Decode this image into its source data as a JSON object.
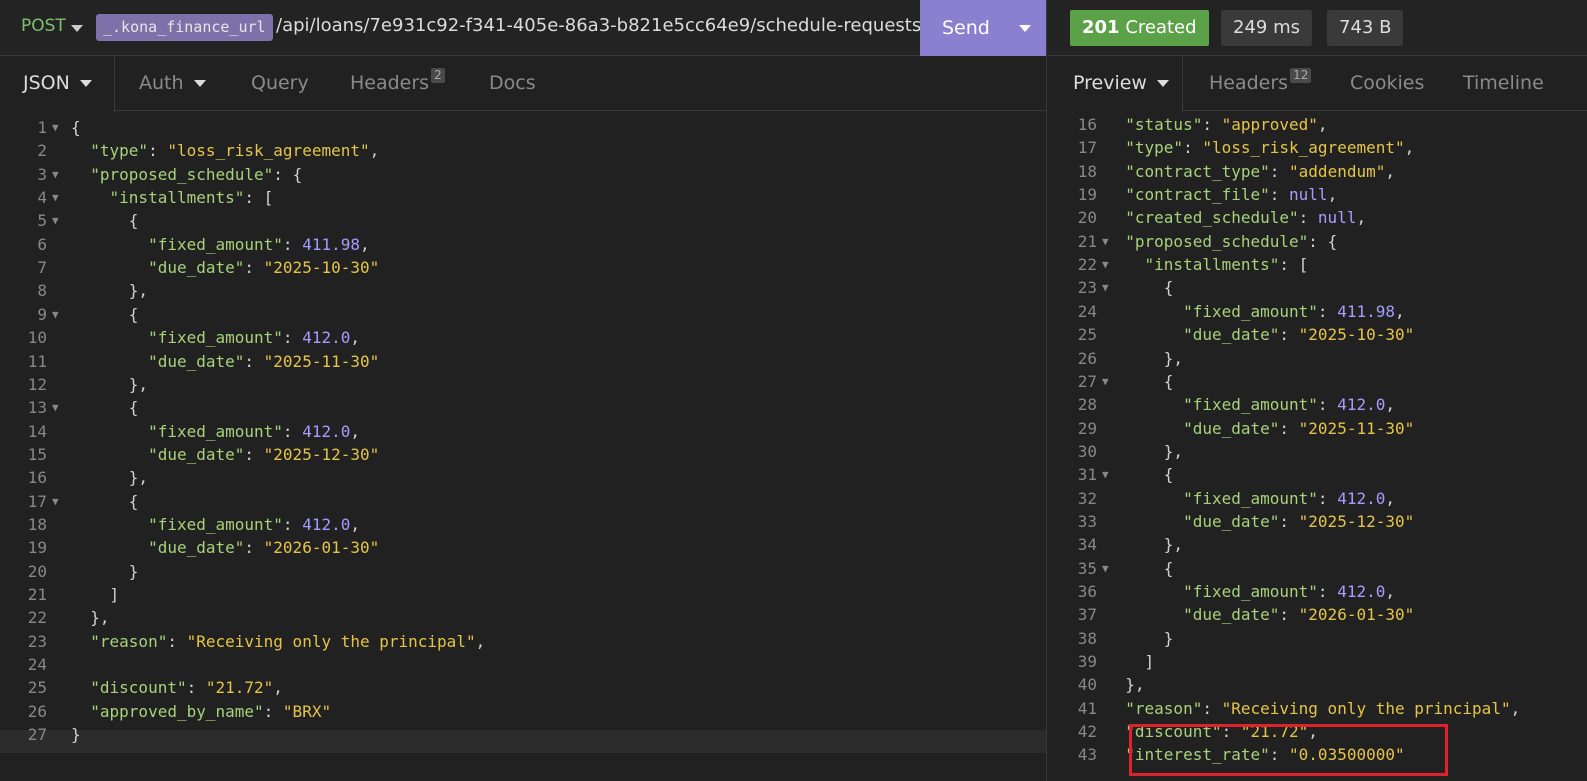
{
  "request": {
    "method": "POST",
    "env_var": "_.kona_finance_url",
    "url_path": "/api/loans/7e931c92-f341-405e-86a3-b821e5cc64e9/schedule-requests/",
    "send_label": "Send"
  },
  "response_meta": {
    "status_code": "201",
    "status_text": "Created",
    "time": "249 ms",
    "size": "743 B"
  },
  "request_tabs": [
    {
      "label": "JSON",
      "active": true
    },
    {
      "label": "Auth"
    },
    {
      "label": "Query"
    },
    {
      "label": "Headers",
      "count": "2"
    },
    {
      "label": "Docs"
    }
  ],
  "response_tabs": [
    {
      "label": "Preview",
      "active": true
    },
    {
      "label": "Headers",
      "count": "12"
    },
    {
      "label": "Cookies"
    },
    {
      "label": "Timeline"
    }
  ],
  "request_body": [
    {
      "n": "1",
      "fold": true,
      "tokens": [
        [
          "p",
          "{"
        ]
      ]
    },
    {
      "n": "2",
      "tokens": [
        [
          "p",
          "  "
        ],
        [
          "k",
          "\"type\""
        ],
        [
          "p",
          ": "
        ],
        [
          "s",
          "\"loss_risk_agreement\""
        ],
        [
          "p",
          ","
        ]
      ]
    },
    {
      "n": "3",
      "fold": true,
      "tokens": [
        [
          "p",
          "  "
        ],
        [
          "k",
          "\"proposed_schedule\""
        ],
        [
          "p",
          ": {"
        ]
      ]
    },
    {
      "n": "4",
      "fold": true,
      "tokens": [
        [
          "p",
          "    "
        ],
        [
          "k",
          "\"installments\""
        ],
        [
          "p",
          ": ["
        ]
      ]
    },
    {
      "n": "5",
      "fold": true,
      "tokens": [
        [
          "p",
          "      {"
        ]
      ]
    },
    {
      "n": "6",
      "tokens": [
        [
          "p",
          "        "
        ],
        [
          "k",
          "\"fixed_amount\""
        ],
        [
          "p",
          ": "
        ],
        [
          "n",
          "411.98"
        ],
        [
          "p",
          ","
        ]
      ]
    },
    {
      "n": "7",
      "tokens": [
        [
          "p",
          "        "
        ],
        [
          "k",
          "\"due_date\""
        ],
        [
          "p",
          ": "
        ],
        [
          "s",
          "\"2025-10-30\""
        ]
      ]
    },
    {
      "n": "8",
      "tokens": [
        [
          "p",
          "      },"
        ]
      ]
    },
    {
      "n": "9",
      "fold": true,
      "tokens": [
        [
          "p",
          "      {"
        ]
      ]
    },
    {
      "n": "10",
      "tokens": [
        [
          "p",
          "        "
        ],
        [
          "k",
          "\"fixed_amount\""
        ],
        [
          "p",
          ": "
        ],
        [
          "n",
          "412.0"
        ],
        [
          "p",
          ","
        ]
      ]
    },
    {
      "n": "11",
      "tokens": [
        [
          "p",
          "        "
        ],
        [
          "k",
          "\"due_date\""
        ],
        [
          "p",
          ": "
        ],
        [
          "s",
          "\"2025-11-30\""
        ]
      ]
    },
    {
      "n": "12",
      "tokens": [
        [
          "p",
          "      },"
        ]
      ]
    },
    {
      "n": "13",
      "fold": true,
      "tokens": [
        [
          "p",
          "      {"
        ]
      ]
    },
    {
      "n": "14",
      "tokens": [
        [
          "p",
          "        "
        ],
        [
          "k",
          "\"fixed_amount\""
        ],
        [
          "p",
          ": "
        ],
        [
          "n",
          "412.0"
        ],
        [
          "p",
          ","
        ]
      ]
    },
    {
      "n": "15",
      "tokens": [
        [
          "p",
          "        "
        ],
        [
          "k",
          "\"due_date\""
        ],
        [
          "p",
          ": "
        ],
        [
          "s",
          "\"2025-12-30\""
        ]
      ]
    },
    {
      "n": "16",
      "tokens": [
        [
          "p",
          "      },"
        ]
      ]
    },
    {
      "n": "17",
      "fold": true,
      "tokens": [
        [
          "p",
          "      {"
        ]
      ]
    },
    {
      "n": "18",
      "tokens": [
        [
          "p",
          "        "
        ],
        [
          "k",
          "\"fixed_amount\""
        ],
        [
          "p",
          ": "
        ],
        [
          "n",
          "412.0"
        ],
        [
          "p",
          ","
        ]
      ]
    },
    {
      "n": "19",
      "tokens": [
        [
          "p",
          "        "
        ],
        [
          "k",
          "\"due_date\""
        ],
        [
          "p",
          ": "
        ],
        [
          "s",
          "\"2026-01-30\""
        ]
      ]
    },
    {
      "n": "20",
      "tokens": [
        [
          "p",
          "      }"
        ]
      ]
    },
    {
      "n": "21",
      "tokens": [
        [
          "p",
          "    ]"
        ]
      ]
    },
    {
      "n": "22",
      "tokens": [
        [
          "p",
          "  },"
        ]
      ]
    },
    {
      "n": "23",
      "tokens": [
        [
          "p",
          "  "
        ],
        [
          "k",
          "\"reason\""
        ],
        [
          "p",
          ": "
        ],
        [
          "s",
          "\"Receiving only the principal\""
        ],
        [
          "p",
          ","
        ]
      ]
    },
    {
      "n": "24",
      "tokens": []
    },
    {
      "n": "25",
      "tokens": [
        [
          "p",
          "  "
        ],
        [
          "k",
          "\"discount\""
        ],
        [
          "p",
          ": "
        ],
        [
          "s",
          "\"21.72\""
        ],
        [
          "p",
          ","
        ]
      ]
    },
    {
      "n": "26",
      "tokens": [
        [
          "p",
          "  "
        ],
        [
          "k",
          "\"approved_by_name\""
        ],
        [
          "p",
          ": "
        ],
        [
          "s",
          "\"BRX\""
        ]
      ]
    },
    {
      "n": "27",
      "tokens": [
        [
          "p",
          "}"
        ]
      ]
    }
  ],
  "response_body": [
    {
      "n": "16",
      "tokens": [
        [
          "p",
          "  "
        ],
        [
          "k",
          "\"status\""
        ],
        [
          "p",
          ": "
        ],
        [
          "s",
          "\"approved\""
        ],
        [
          "p",
          ","
        ]
      ]
    },
    {
      "n": "17",
      "tokens": [
        [
          "p",
          "  "
        ],
        [
          "k",
          "\"type\""
        ],
        [
          "p",
          ": "
        ],
        [
          "s",
          "\"loss_risk_agreement\""
        ],
        [
          "p",
          ","
        ]
      ]
    },
    {
      "n": "18",
      "tokens": [
        [
          "p",
          "  "
        ],
        [
          "k",
          "\"contract_type\""
        ],
        [
          "p",
          ": "
        ],
        [
          "s",
          "\"addendum\""
        ],
        [
          "p",
          ","
        ]
      ]
    },
    {
      "n": "19",
      "tokens": [
        [
          "p",
          "  "
        ],
        [
          "k",
          "\"contract_file\""
        ],
        [
          "p",
          ": "
        ],
        [
          "nu",
          "null"
        ],
        [
          "p",
          ","
        ]
      ]
    },
    {
      "n": "20",
      "tokens": [
        [
          "p",
          "  "
        ],
        [
          "k",
          "\"created_schedule\""
        ],
        [
          "p",
          ": "
        ],
        [
          "nu",
          "null"
        ],
        [
          "p",
          ","
        ]
      ]
    },
    {
      "n": "21",
      "fold": true,
      "tokens": [
        [
          "p",
          "  "
        ],
        [
          "k",
          "\"proposed_schedule\""
        ],
        [
          "p",
          ": {"
        ]
      ]
    },
    {
      "n": "22",
      "fold": true,
      "tokens": [
        [
          "p",
          "    "
        ],
        [
          "k",
          "\"installments\""
        ],
        [
          "p",
          ": ["
        ]
      ]
    },
    {
      "n": "23",
      "fold": true,
      "tokens": [
        [
          "p",
          "      {"
        ]
      ]
    },
    {
      "n": "24",
      "tokens": [
        [
          "p",
          "        "
        ],
        [
          "k",
          "\"fixed_amount\""
        ],
        [
          "p",
          ": "
        ],
        [
          "n",
          "411.98"
        ],
        [
          "p",
          ","
        ]
      ]
    },
    {
      "n": "25",
      "tokens": [
        [
          "p",
          "        "
        ],
        [
          "k",
          "\"due_date\""
        ],
        [
          "p",
          ": "
        ],
        [
          "s",
          "\"2025-10-30\""
        ]
      ]
    },
    {
      "n": "26",
      "tokens": [
        [
          "p",
          "      },"
        ]
      ]
    },
    {
      "n": "27",
      "fold": true,
      "tokens": [
        [
          "p",
          "      {"
        ]
      ]
    },
    {
      "n": "28",
      "tokens": [
        [
          "p",
          "        "
        ],
        [
          "k",
          "\"fixed_amount\""
        ],
        [
          "p",
          ": "
        ],
        [
          "n",
          "412.0"
        ],
        [
          "p",
          ","
        ]
      ]
    },
    {
      "n": "29",
      "tokens": [
        [
          "p",
          "        "
        ],
        [
          "k",
          "\"due_date\""
        ],
        [
          "p",
          ": "
        ],
        [
          "s",
          "\"2025-11-30\""
        ]
      ]
    },
    {
      "n": "30",
      "tokens": [
        [
          "p",
          "      },"
        ]
      ]
    },
    {
      "n": "31",
      "fold": true,
      "tokens": [
        [
          "p",
          "      {"
        ]
      ]
    },
    {
      "n": "32",
      "tokens": [
        [
          "p",
          "        "
        ],
        [
          "k",
          "\"fixed_amount\""
        ],
        [
          "p",
          ": "
        ],
        [
          "n",
          "412.0"
        ],
        [
          "p",
          ","
        ]
      ]
    },
    {
      "n": "33",
      "tokens": [
        [
          "p",
          "        "
        ],
        [
          "k",
          "\"due_date\""
        ],
        [
          "p",
          ": "
        ],
        [
          "s",
          "\"2025-12-30\""
        ]
      ]
    },
    {
      "n": "34",
      "tokens": [
        [
          "p",
          "      },"
        ]
      ]
    },
    {
      "n": "35",
      "fold": true,
      "tokens": [
        [
          "p",
          "      {"
        ]
      ]
    },
    {
      "n": "36",
      "tokens": [
        [
          "p",
          "        "
        ],
        [
          "k",
          "\"fixed_amount\""
        ],
        [
          "p",
          ": "
        ],
        [
          "n",
          "412.0"
        ],
        [
          "p",
          ","
        ]
      ]
    },
    {
      "n": "37",
      "tokens": [
        [
          "p",
          "        "
        ],
        [
          "k",
          "\"due_date\""
        ],
        [
          "p",
          ": "
        ],
        [
          "s",
          "\"2026-01-30\""
        ]
      ]
    },
    {
      "n": "38",
      "tokens": [
        [
          "p",
          "      }"
        ]
      ]
    },
    {
      "n": "39",
      "tokens": [
        [
          "p",
          "    ]"
        ]
      ]
    },
    {
      "n": "40",
      "tokens": [
        [
          "p",
          "  },"
        ]
      ]
    },
    {
      "n": "41",
      "tokens": [
        [
          "p",
          "  "
        ],
        [
          "k",
          "\"reason\""
        ],
        [
          "p",
          ": "
        ],
        [
          "s",
          "\"Receiving only the principal\""
        ],
        [
          "p",
          ","
        ]
      ]
    },
    {
      "n": "42",
      "tokens": [
        [
          "p",
          "  "
        ],
        [
          "k",
          "\"discount\""
        ],
        [
          "p",
          ": "
        ],
        [
          "s",
          "\"21.72\""
        ],
        [
          "p",
          ","
        ]
      ]
    },
    {
      "n": "43",
      "tokens": [
        [
          "p",
          "  "
        ],
        [
          "k",
          "\"interest_rate\""
        ],
        [
          "p",
          ": "
        ],
        [
          "s",
          "\"0.03500000\""
        ]
      ]
    }
  ],
  "colors": {
    "send": "#8b7fcf",
    "status_ok": "#5ba148",
    "highlight": "#e0232b",
    "json_key": "#a6d27a",
    "json_string": "#e5c547",
    "json_number": "#a89bff"
  }
}
